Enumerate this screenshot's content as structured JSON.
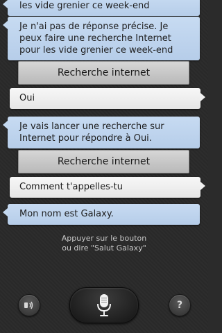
{
  "conversation": [
    {
      "role": "galaxy",
      "text": "les vide grenier ce week-end"
    },
    {
      "role": "galaxy",
      "text": "Je n'ai pas de réponse précise. Je peux faire une recherche Internet pour les vide grenier ce week-end"
    },
    {
      "role": "action",
      "text": "Recherche internet"
    },
    {
      "role": "user",
      "text": "Oui"
    },
    {
      "role": "galaxy",
      "text": "Je vais lancer une recherche sur Internet pour répondre à Oui."
    },
    {
      "role": "action",
      "text": "Recherche internet"
    },
    {
      "role": "user",
      "text": "Comment t'appelles-tu"
    },
    {
      "role": "galaxy",
      "text": "Mon nom est Galaxy."
    }
  ],
  "hint": {
    "line1": "Appuyer sur le bouton",
    "line2": "ou dire \"Salut Galaxy\""
  },
  "controls": {
    "speaker_icon": "speaker-icon",
    "mic_icon": "microphone-icon",
    "help_label": "?"
  },
  "colors": {
    "galaxy_bubble": "#c7dbf2",
    "user_bubble": "#f2f2f2",
    "action_button": "#c8c8c8",
    "background": "#2a2a2a"
  }
}
